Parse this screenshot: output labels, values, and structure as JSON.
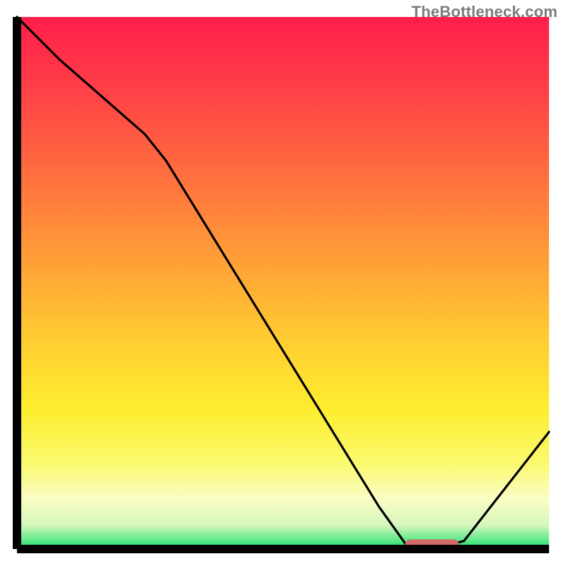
{
  "attribution": "TheBottleneck.com",
  "colors": {
    "attribution_text": "#7c7c7c",
    "frame": "#000000",
    "curve": "#000000",
    "marker_fill": "#d56a6a",
    "marker_stroke": "#cf5a5a",
    "gradient_stops": [
      {
        "offset": 0.0,
        "color": "#ff1e4a"
      },
      {
        "offset": 0.12,
        "color": "#ff3b47"
      },
      {
        "offset": 0.3,
        "color": "#ff6f3e"
      },
      {
        "offset": 0.48,
        "color": "#ffa636"
      },
      {
        "offset": 0.62,
        "color": "#ffd030"
      },
      {
        "offset": 0.74,
        "color": "#fdee2f"
      },
      {
        "offset": 0.84,
        "color": "#faf970"
      },
      {
        "offset": 0.905,
        "color": "#fbfdc3"
      },
      {
        "offset": 0.955,
        "color": "#d6f7bd"
      },
      {
        "offset": 0.985,
        "color": "#57e887"
      },
      {
        "offset": 1.0,
        "color": "#18dd6e"
      }
    ]
  },
  "chart_data": {
    "type": "line",
    "title": "",
    "xlabel": "",
    "ylabel": "",
    "xlim": [
      0,
      100
    ],
    "ylim": [
      0,
      100
    ],
    "series": [
      {
        "name": "bottleneck-curve",
        "x": [
          0,
          8,
          24,
          28,
          68,
          73,
          80,
          84,
          100
        ],
        "values": [
          100,
          92,
          78,
          73,
          8,
          1,
          0.5,
          1.5,
          22
        ]
      }
    ],
    "marker": {
      "name": "optimal-range",
      "x_start": 73,
      "x_end": 83,
      "y": 0.8
    },
    "legend": null,
    "annotations": []
  }
}
